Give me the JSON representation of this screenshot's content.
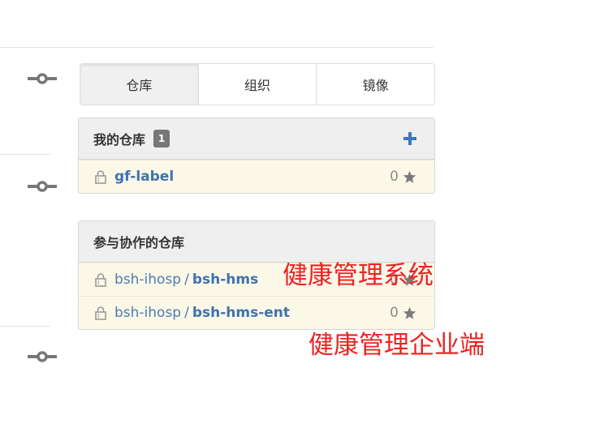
{
  "tabs": [
    {
      "label": "仓库",
      "active": true
    },
    {
      "label": "组织",
      "active": false
    },
    {
      "label": "镜像",
      "active": false
    }
  ],
  "my_repos": {
    "title": "我的仓库",
    "count": "1",
    "items": [
      {
        "owner": "",
        "sep": "",
        "name": "gf-label",
        "stars": "0"
      }
    ]
  },
  "collab_repos": {
    "title": "参与协作的仓库",
    "items": [
      {
        "owner": "bsh-ihosp",
        "sep": "/",
        "name": "bsh-hms",
        "stars": "0"
      },
      {
        "owner": "bsh-ihosp",
        "sep": "/",
        "name": "bsh-hms-ent",
        "stars": "0"
      }
    ]
  },
  "annotations": {
    "first": "健康管理系统",
    "second": "健康管理企业端"
  },
  "colors": {
    "link": "#4a7cb5",
    "annotation": "#ee2222",
    "badge": "#777777",
    "add": "#3b78c2"
  },
  "icons": [
    "commit-icon",
    "lock-icon",
    "star-icon",
    "plus-icon"
  ]
}
